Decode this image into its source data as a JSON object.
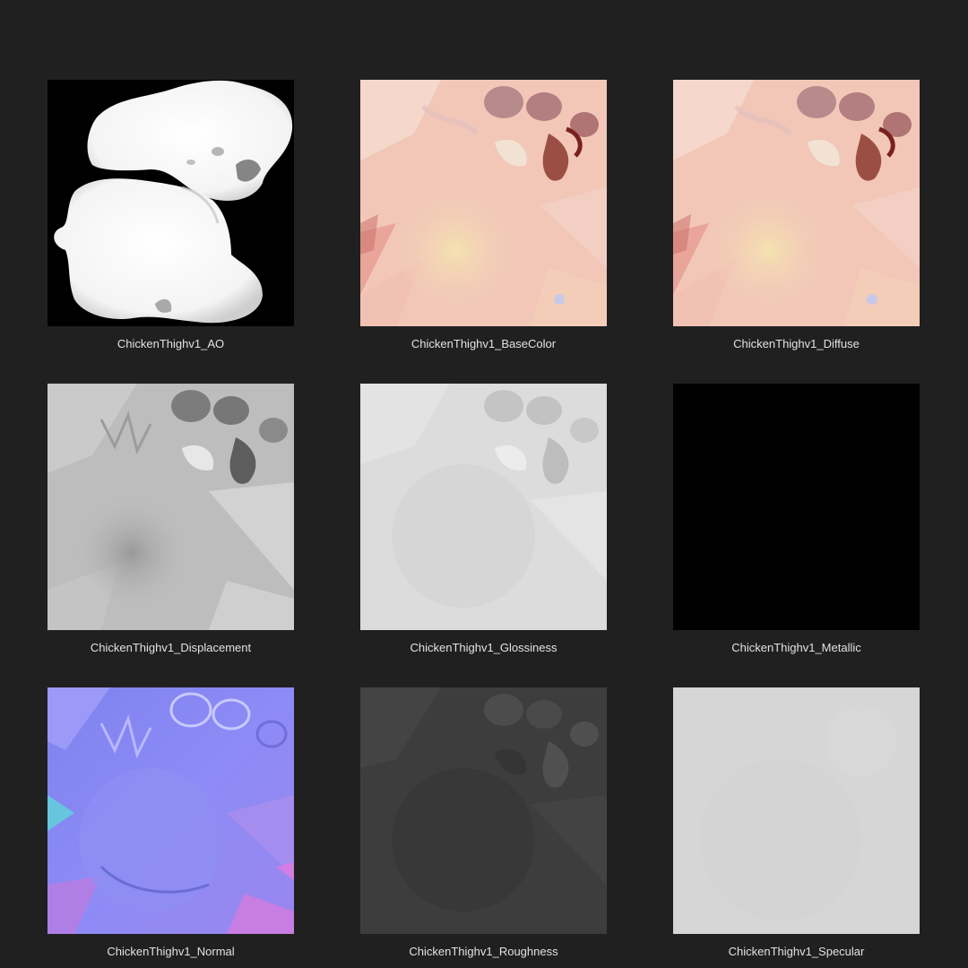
{
  "files": [
    {
      "name": "ChickenThighv1_AO",
      "kind": "ao"
    },
    {
      "name": "ChickenThighv1_BaseColor",
      "kind": "basecolor"
    },
    {
      "name": "ChickenThighv1_Diffuse",
      "kind": "diffuse"
    },
    {
      "name": "ChickenThighv1_Displacement",
      "kind": "displacement"
    },
    {
      "name": "ChickenThighv1_Glossiness",
      "kind": "glossiness"
    },
    {
      "name": "ChickenThighv1_Metallic",
      "kind": "metallic"
    },
    {
      "name": "ChickenThighv1_Normal",
      "kind": "normal"
    },
    {
      "name": "ChickenThighv1_Roughness",
      "kind": "roughness"
    },
    {
      "name": "ChickenThighv1_Specular",
      "kind": "specular"
    }
  ],
  "colors": {
    "background": "#202020",
    "caption": "#e2e2e2",
    "skin_base": "#f2c7b8",
    "normal_base": "#8a88f0",
    "metallic": "#000000",
    "specular": "#d6d6d6"
  }
}
